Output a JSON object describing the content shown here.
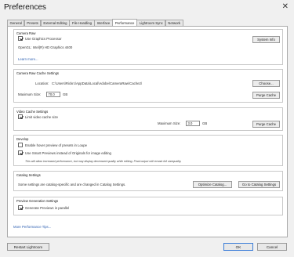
{
  "window": {
    "title": "Preferences",
    "close_glyph": "✕"
  },
  "tabs": [
    "General",
    "Presets",
    "External Editing",
    "File Handling",
    "Interface",
    "Performance",
    "Lightroom Sync",
    "Network"
  ],
  "camera_raw": {
    "title": "Camera Raw",
    "use_gpu_label": "Use Graphics Processor",
    "use_gpu_checked": true,
    "opengl_info": "OpenGL: Intel(R) HD Graphics 4400",
    "learn_more": "Learn more...",
    "system_info_button": "System Info"
  },
  "cache": {
    "title": "Camera Raw Cache Settings",
    "location_label": "Location:",
    "location_value": "C:\\Users\\Rickrc\\AppData\\Local\\Adobe\\CameraRaw\\Cache2\\",
    "choose_button": "Choose...",
    "max_size_label": "Maximum Size:",
    "max_size_value": "70.0",
    "max_size_unit": "GB",
    "purge_button": "Purge Cache"
  },
  "video_cache": {
    "title": "Video Cache Settings",
    "limit_label": "Limit video cache size",
    "limit_checked": true,
    "max_size_label": "Maximum Size:",
    "max_size_value": "3.0",
    "max_size_unit": "GB",
    "purge_button": "Purge Cache"
  },
  "develop": {
    "title": "Develop",
    "hover_preview_label": "Enable hover preview of presets in Loupe",
    "hover_preview_checked": false,
    "smart_previews_label": "Use Smart Previews instead of Originals for image editing",
    "smart_previews_checked": true,
    "smart_previews_note": "This will allow increased performance, but may display decreased quality while editing. Final output will remain full sizequality."
  },
  "catalog": {
    "title": "Catalog Settings",
    "text": "Some settings are catalog-specific and are changed in Catalog Settings.",
    "optimize_button": "Optimize Catalog...",
    "goto_button": "Go to Catalog Settings"
  },
  "preview_gen": {
    "title": "Preview Generation Settings",
    "parallel_label": "Generate Previews in parallel",
    "parallel_checked": true
  },
  "more_tips": "More Performance Tips...",
  "footer": {
    "restart_button": "Restart Lightroom",
    "ok_button": "OK",
    "cancel_button": "Cancel"
  },
  "colors": {
    "link": "#2a5db0",
    "background": "#f0f0f0",
    "panel": "#ffffff"
  }
}
